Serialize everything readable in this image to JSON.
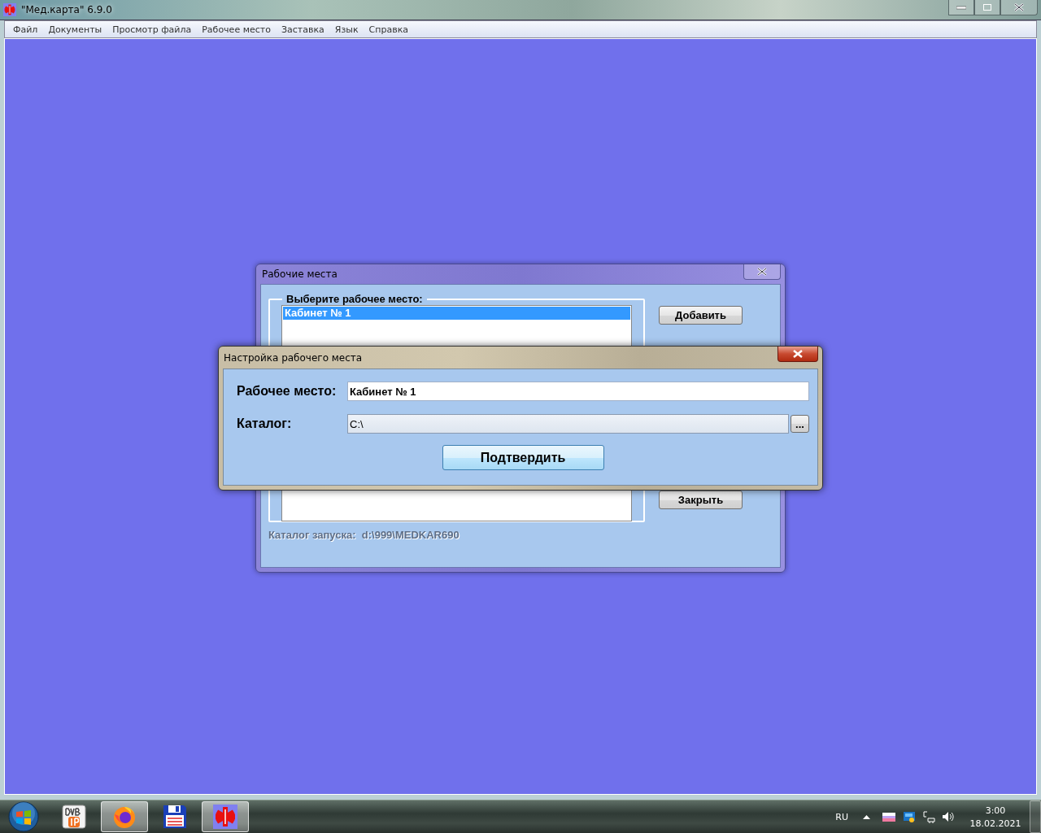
{
  "app_window": {
    "title": "\"Мед.карта\" 6.9.0",
    "menu": [
      "Файл",
      "Документы",
      "Просмотр файла",
      "Рабочее место",
      "Заставка",
      "Язык",
      "Справка"
    ]
  },
  "workplaces_dialog": {
    "title": "Рабочие места",
    "group_label": "Выберите рабочее место:",
    "list_items": [
      {
        "label": "Кабинет № 1",
        "selected": true
      }
    ],
    "buttons": [
      "Добавить",
      "Закрыть"
    ],
    "launch_dir_label": "Каталог запуска:",
    "launch_dir": "d:\\999\\MEDKAR690"
  },
  "settings_dialog": {
    "title": "Настройка рабочего места",
    "fields": [
      {
        "kind": "text",
        "label": "Рабочее место:",
        "value": "Кабинет № 1"
      },
      {
        "kind": "browse",
        "label": "Каталог:",
        "value": "C:\\",
        "browse_label": "..."
      }
    ],
    "confirm": "Подтвердить"
  },
  "taskbar": {
    "apps": [
      {
        "kind": "dvb",
        "running": false
      },
      {
        "kind": "firefox",
        "running": true
      },
      {
        "kind": "floppy",
        "running": false
      },
      {
        "kind": "medcard",
        "running": true
      }
    ],
    "language": "RU",
    "time": "3:00",
    "date": "18.02.2021"
  }
}
